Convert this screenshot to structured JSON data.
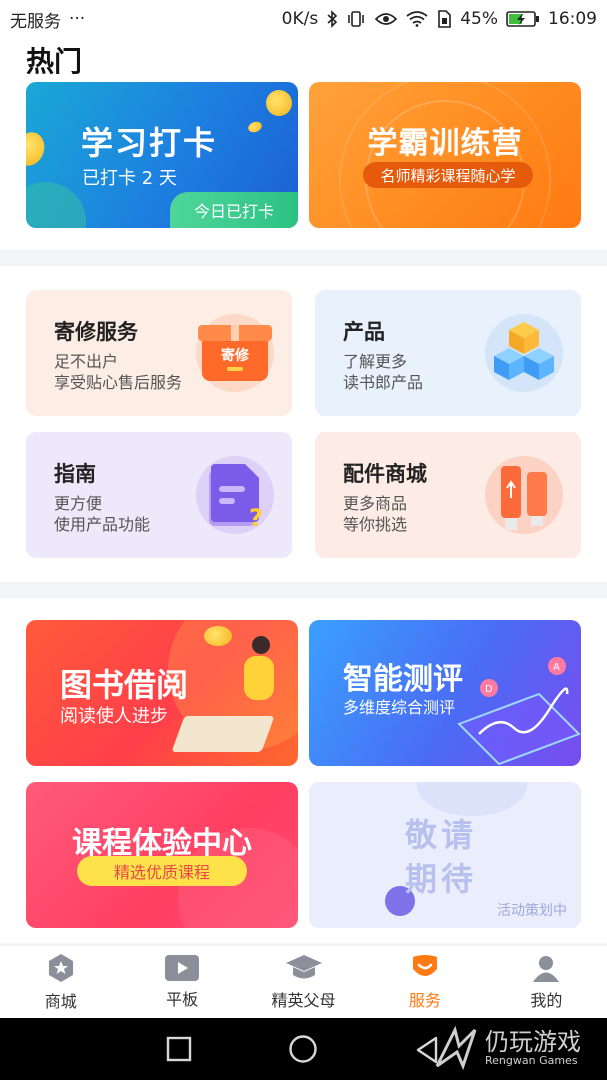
{
  "status_bar": {
    "carrier": "无服务",
    "more": "···",
    "speed": "0K/s",
    "battery": "45%",
    "time": "16:09"
  },
  "hot": {
    "title": "热门",
    "study_card": {
      "title": "学习打卡",
      "subtitle": "已打卡 2 天",
      "badge": "今日已打卡"
    },
    "camp_card": {
      "title": "学霸训练营",
      "subtitle": "名师精彩课程随心学"
    }
  },
  "services": [
    {
      "title": "寄修服务",
      "line1": "足不出户",
      "line2": "享受贴心售后服务",
      "icon": "repair-box-icon",
      "icon_text": "寄修",
      "bg": "#fdeee5"
    },
    {
      "title": "产品",
      "line1": "了解更多",
      "line2": "读书郎产品",
      "icon": "cubes-icon",
      "bg": "#e8f1fc"
    },
    {
      "title": "指南",
      "line1": "更方便",
      "line2": "使用产品功能",
      "icon": "guide-doc-icon",
      "bg": "#eee8fb"
    },
    {
      "title": "配件商城",
      "line1": "更多商品",
      "line2": "等你挑选",
      "icon": "usb-cable-icon",
      "bg": "#fdece6"
    }
  ],
  "features": {
    "library": {
      "title": "图书借阅",
      "subtitle": "阅读使人进步"
    },
    "assessment": {
      "title": "智能测评",
      "subtitle": "多维度综合测评"
    },
    "course": {
      "title": "课程体验中心",
      "subtitle": "精选优质课程"
    },
    "coming": {
      "title_line1": "敬请",
      "title_line2": "期待",
      "subtitle": "活动策划中"
    }
  },
  "tabs": [
    {
      "label": "商城",
      "icon": "star-hexagon-icon",
      "active": false
    },
    {
      "label": "平板",
      "icon": "play-icon",
      "active": false
    },
    {
      "label": "精英父母",
      "icon": "graduation-cap-icon",
      "active": false
    },
    {
      "label": "服务",
      "icon": "service-icon",
      "active": true
    },
    {
      "label": "我的",
      "icon": "user-icon",
      "active": false
    }
  ],
  "watermark": {
    "cn": "仍玩游戏",
    "en": "Rengwan Games"
  },
  "colors": {
    "accent": "#ff7a12",
    "blue": "#1d7fe0"
  }
}
